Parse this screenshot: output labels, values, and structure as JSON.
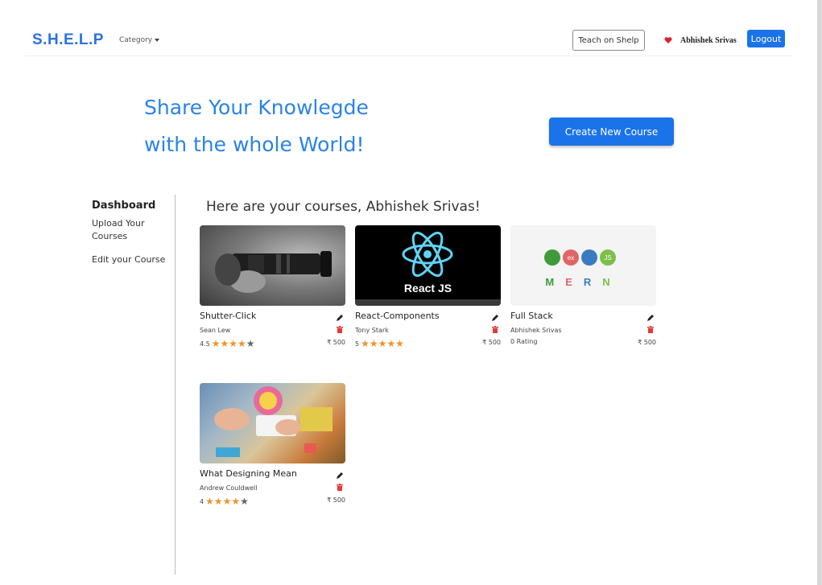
{
  "navbar": {
    "brand": "S.H.E.L.P",
    "category_label": "Category",
    "teach_label": "Teach on Shelp",
    "user_name": "Abhishek Srivas",
    "logout_label": "Logout"
  },
  "hero": {
    "line1": "Share Your Knowlegde",
    "line2": "with the whole World!",
    "create_label": "Create New Course"
  },
  "sidebar": {
    "title": "Dashboard",
    "upload_label": "Upload Your Courses",
    "edit_label": "Edit your Course"
  },
  "main": {
    "heading": "Here are your courses, Abhishek Srivas!",
    "courses": [
      {
        "title": "Shutter-Click",
        "author": "Sean Lew",
        "rating_text": "4.5",
        "rating_value": 4.5,
        "price": "₹ 500",
        "thumb": "camera-photo"
      },
      {
        "title": "React-Components",
        "author": "Tony Stark",
        "rating_text": "5",
        "rating_value": 5,
        "price": "₹ 500",
        "thumb": "react-logo",
        "thumb_caption": "React JS"
      },
      {
        "title": "Full Stack",
        "author": "Abhishek Srivas",
        "rating_text": "0 Rating",
        "rating_value": 0,
        "price": "₹ 500",
        "thumb": "mern-logo",
        "thumb_caption": "MERN"
      },
      {
        "title": "What Designing Mean",
        "author": "Andrew Couldwell",
        "rating_text": "4",
        "rating_value": 4,
        "price": "₹ 500",
        "thumb": "design-desk-photo"
      }
    ]
  },
  "colors": {
    "brand": "#2a72e0",
    "accent": "#1a73e8",
    "hero_text": "#2a83e8",
    "star": "#f0922b",
    "delete": "#e53935",
    "heart": "#e0202e"
  }
}
